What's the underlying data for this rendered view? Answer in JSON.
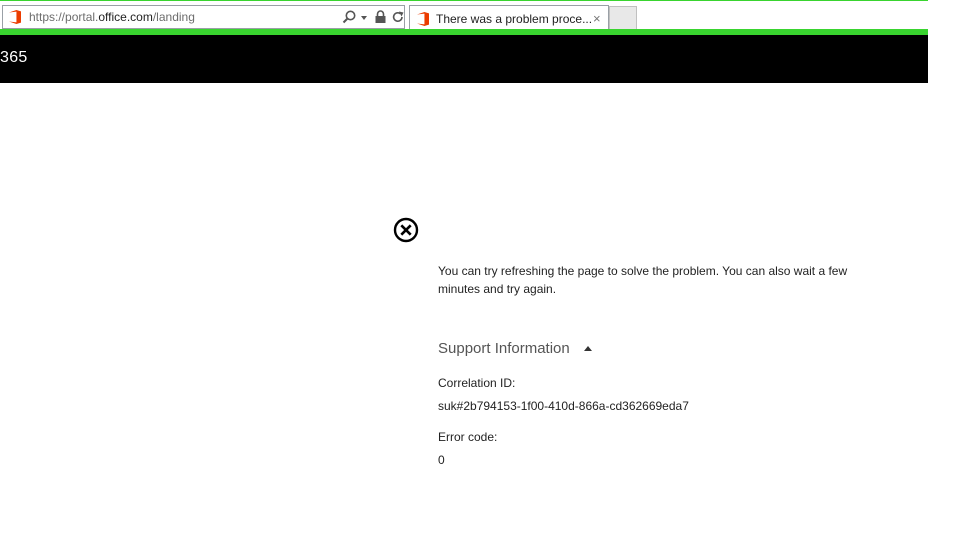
{
  "browser": {
    "url_prefix": "https://portal.",
    "url_domain": "office.com",
    "url_path": "/landing",
    "tab_title": "There was a problem proce...",
    "tab_close": "×",
    "icons": [
      "office-logo-icon",
      "search-icon",
      "chevron-down-icon",
      "lock-icon",
      "refresh-icon",
      "close-icon"
    ],
    "accent_color": "#39d42f"
  },
  "header": {
    "app_name": "365",
    "background": "#000000"
  },
  "error": {
    "icon": "error-circle-x-icon",
    "message": "You can try refreshing the page to solve the problem. You can also wait a few minutes and try again.",
    "support_heading": "Support Information",
    "correlation_label": "Correlation ID:",
    "correlation_value": "suk#2b794153-1f00-410d-866a-cd362669eda7",
    "error_code_label": "Error code:",
    "error_code_value": "0"
  }
}
